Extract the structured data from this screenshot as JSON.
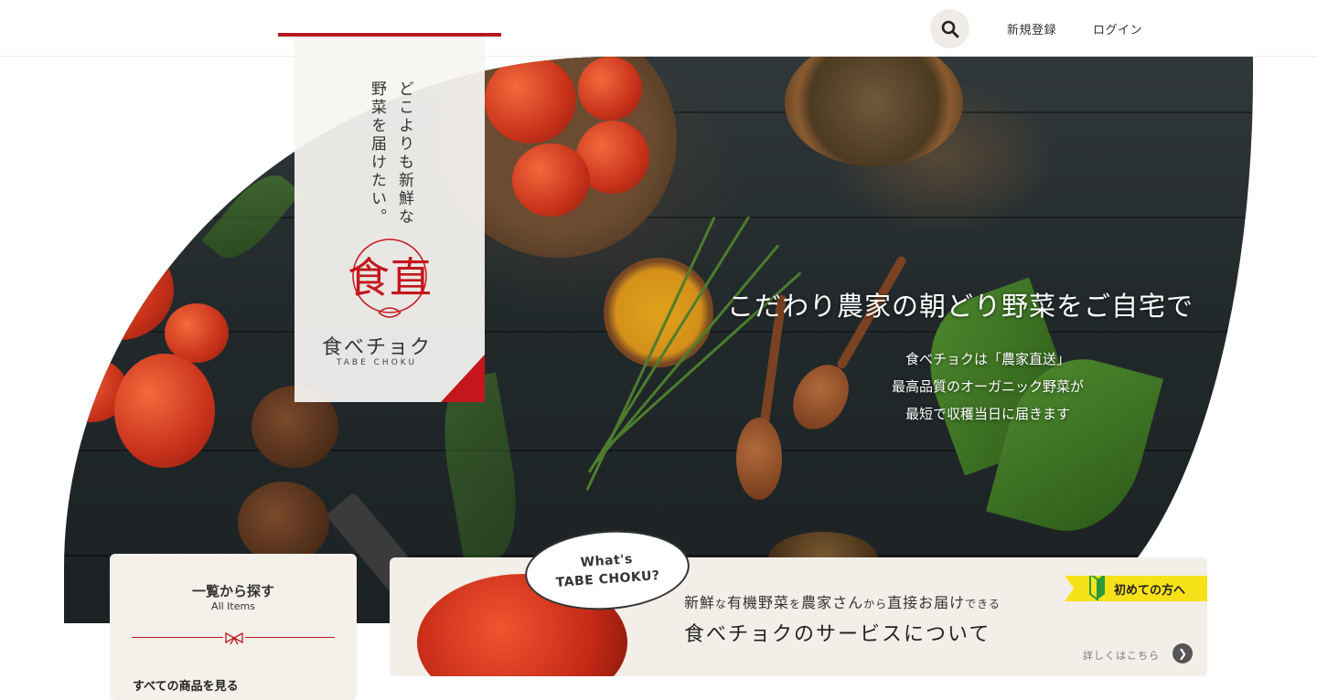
{
  "header": {
    "search_icon": "search-icon",
    "register_label": "新規登録",
    "login_label": "ログイン"
  },
  "brand_card": {
    "tagline_line1": "どこよりも新鮮な",
    "tagline_line2": "野菜を届けたい。",
    "logo_kanji": "食直",
    "name": "食べチョク",
    "name_en": "TABE CHOKU",
    "accent_color": "#b3191f"
  },
  "hero": {
    "title": "こだわり農家の朝どり野菜をご自宅で",
    "sub_lines": [
      "食べチョクは「農家直送」",
      "最高品質のオーガニック野菜が",
      "最短で収穫当日に届きます"
    ]
  },
  "list_card": {
    "title": "一覧から探す",
    "subtitle": "All Items",
    "link_label": "すべての商品を見る"
  },
  "about_card": {
    "bubble_line1": "What's",
    "bubble_line2": "TABE CHOKU?",
    "line1_parts": [
      "新鮮",
      "な",
      "有機野菜",
      "を",
      "農家さん",
      "から",
      "直接お届け",
      "できる"
    ],
    "title": "食べチョクのサービスについて",
    "more_label": "詳しくはこちら",
    "first_time_label": "初めての方へ",
    "tag_color": "#f7e21a"
  }
}
